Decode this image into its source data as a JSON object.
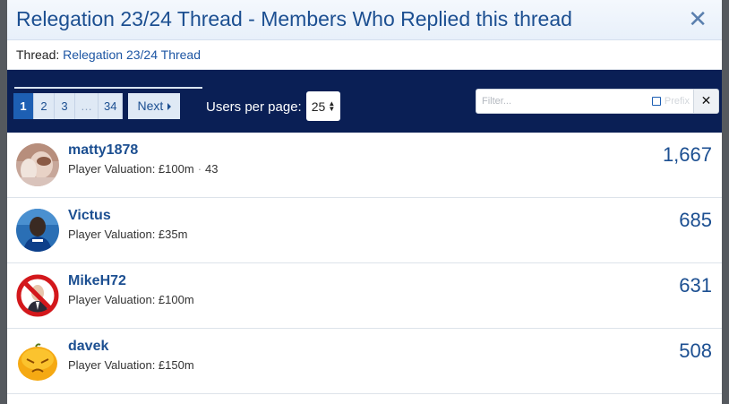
{
  "dialog": {
    "title": "Relegation 23/24 Thread - Members Who Replied this thread",
    "close_glyph": "✕"
  },
  "thread": {
    "label": "Thread:",
    "link_text": "Relegation 23/24 Thread"
  },
  "pagination": {
    "pages": [
      "1",
      "2",
      "3",
      "…",
      "34"
    ],
    "current_page": "1",
    "next_label": "Next"
  },
  "users_per_page": {
    "label": "Users per page:",
    "value": "25"
  },
  "filter": {
    "placeholder": "Filter...",
    "prefix_label": "Prefix",
    "clear_glyph": "✕"
  },
  "members": [
    {
      "name": "matty1878",
      "valuation": "Player Valuation: £100m",
      "extra": "43",
      "count": "1,667",
      "avatar": "photo-avatar"
    },
    {
      "name": "Victus",
      "valuation": "Player Valuation: £35m",
      "extra": "",
      "count": "685",
      "avatar": "player-avatar"
    },
    {
      "name": "MikeH72",
      "valuation": "Player Valuation: £100m",
      "extra": "",
      "count": "631",
      "avatar": "no-sign-avatar"
    },
    {
      "name": "davek",
      "valuation": "Player Valuation: £150m",
      "extra": "",
      "count": "508",
      "avatar": "angry-orange-avatar"
    }
  ],
  "colors": {
    "header_blue": "#1c4f91",
    "nav_navy": "#0a1f55",
    "current_page": "#1d5fb3"
  }
}
